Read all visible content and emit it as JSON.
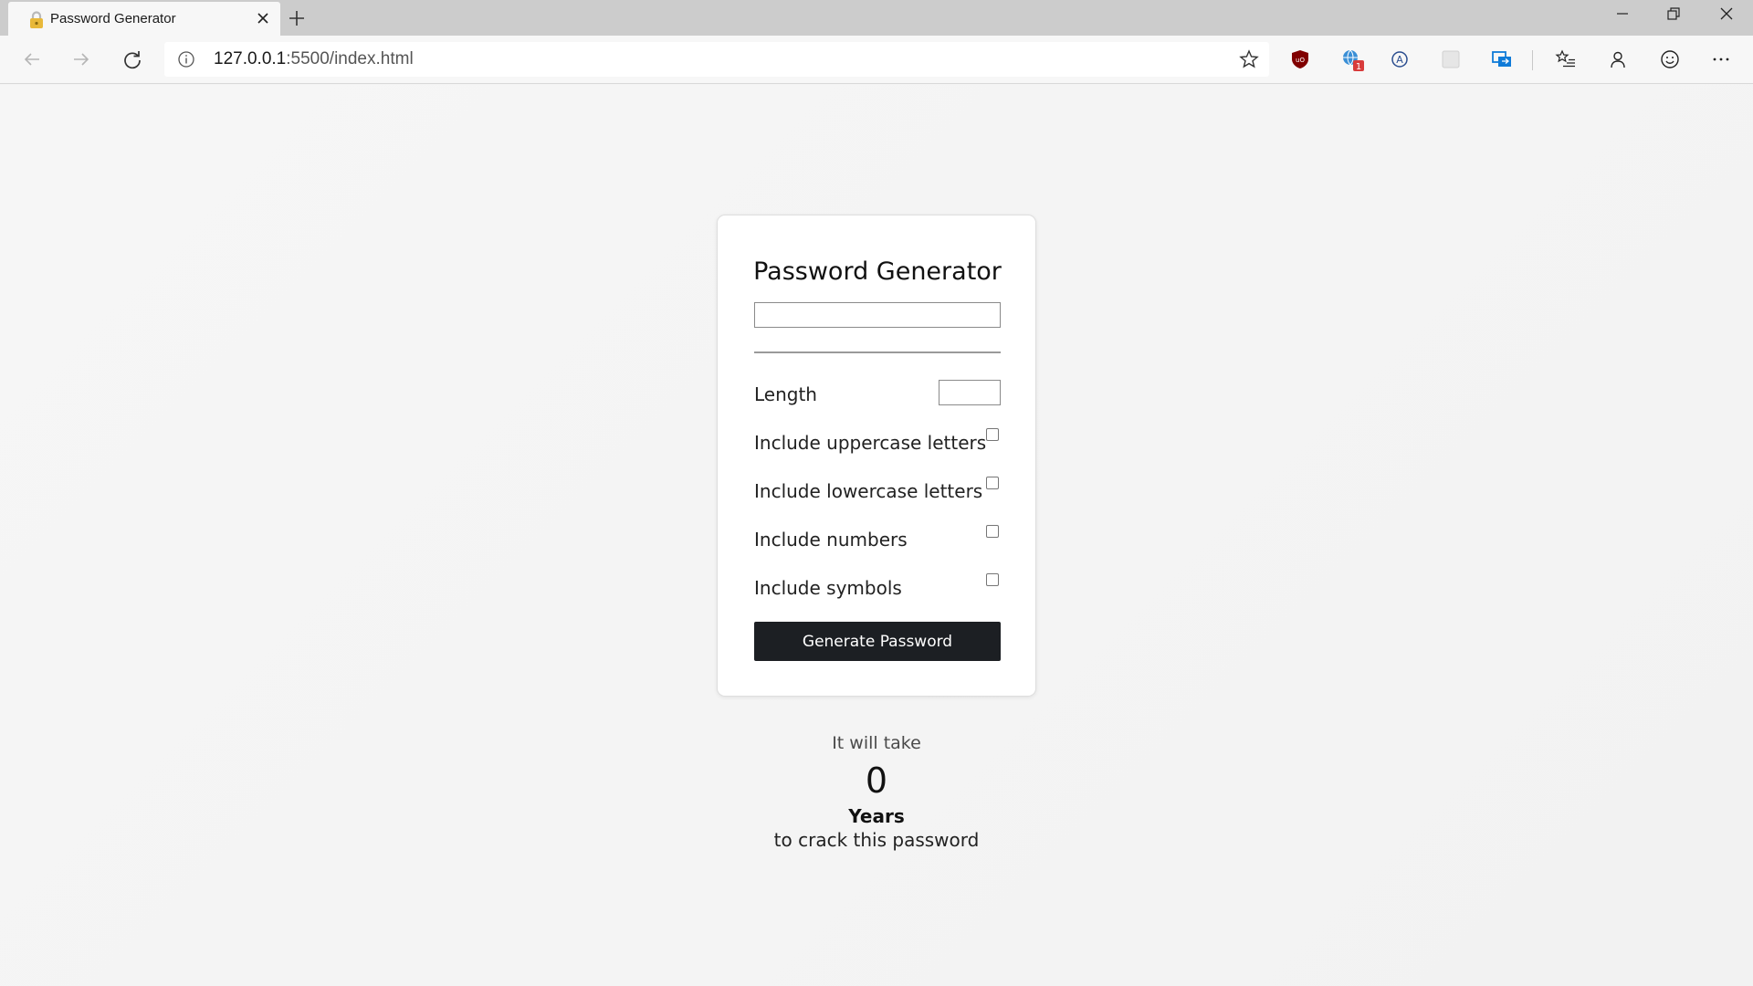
{
  "browser": {
    "tab": {
      "title": "Password Generator"
    },
    "address": {
      "host": "127.0.0.1",
      "rest": ":5500/index.html"
    }
  },
  "app": {
    "title": "Password Generator",
    "password_value": "",
    "length_value": "",
    "length_label": "Length",
    "options": [
      {
        "label": "Include uppercase letters"
      },
      {
        "label": "Include lowercase letters"
      },
      {
        "label": "Include numbers"
      },
      {
        "label": "Include symbols"
      }
    ],
    "generate_label": "Generate Password"
  },
  "result": {
    "prefix": "It will take",
    "value": "0",
    "unit": "Years",
    "suffix": "to crack this password"
  }
}
